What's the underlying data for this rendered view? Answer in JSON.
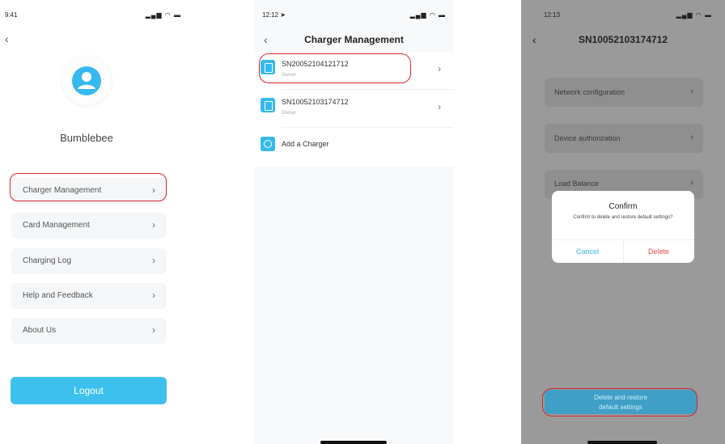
{
  "screen1": {
    "status_time": "9:41",
    "status_icons": "▂▄▆ ◠ ▬",
    "back_icon": "‹",
    "username": "Bumblebee",
    "menu": [
      {
        "label": "Charger Management",
        "chevron": "›"
      },
      {
        "label": "Card Management",
        "chevron": "›"
      },
      {
        "label": "Charging Log",
        "chevron": "›"
      },
      {
        "label": "Help and Feedback",
        "chevron": "›"
      },
      {
        "label": "About Us",
        "chevron": "›"
      }
    ],
    "logout": "Logout"
  },
  "screen2": {
    "status_time": "12:12 ➤",
    "status_icons": "▂▄▆ ◠ ▬",
    "back_icon": "‹",
    "title": "Charger Management",
    "chargers": [
      {
        "sn": "SN20052104121712",
        "role": "Owner",
        "chevron": "›"
      },
      {
        "sn": "SN10052103174712",
        "role": "Owner",
        "chevron": "›"
      }
    ],
    "add_label": "Add a Charger"
  },
  "screen3": {
    "status_time": "12:13",
    "status_icons": "▂▄▆ ◠ ▬",
    "back_icon": "‹",
    "title": "SN10052103174712",
    "options": [
      {
        "label": "Network configuration",
        "chevron": "›"
      },
      {
        "label": "Device authorization",
        "chevron": "›"
      },
      {
        "label": "Load Balance",
        "chevron": "›"
      }
    ],
    "dialog": {
      "title": "Confirm",
      "message": "Confirm to delete and restore default settings?",
      "cancel": "Cancel",
      "delete": "Delete"
    },
    "restore_line1": "Delete and restore",
    "restore_line2": "default settings"
  },
  "colors": {
    "accent": "#3ec0ee",
    "highlight": "#d8262a",
    "delete": "#ef4a4a",
    "overlay": "#9a9a9a"
  }
}
